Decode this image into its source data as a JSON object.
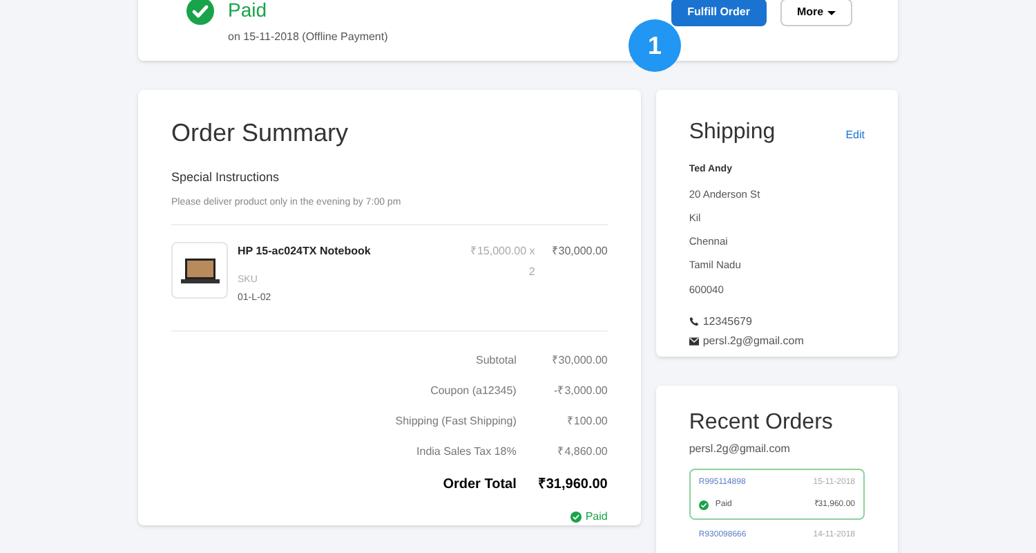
{
  "payment": {
    "status": "Paid",
    "detail": "on 15-11-2018 (Offline Payment)",
    "actions": [
      {
        "label": "Fulfill Order",
        "kind": "primary"
      },
      {
        "label": "More",
        "kind": "dropdown"
      }
    ]
  },
  "step_badge": "1",
  "order_summary": {
    "title": "Order Summary",
    "instructions_label": "Special Instructions",
    "instructions": "Please deliver product only in the evening by 7:00 pm",
    "items": [
      {
        "name": "HP 15-ac024TX Notebook",
        "sku_label": "SKU",
        "sku": "01-L-02",
        "unit_price": "₹15,000.00 x",
        "quantity": "2",
        "total": "₹30,000.00"
      }
    ],
    "totals": [
      {
        "label": "Subtotal",
        "value": "₹30,000.00",
        "kind": "line"
      },
      {
        "label": "Coupon (a12345)",
        "value": "-₹3,000.00",
        "kind": "line"
      },
      {
        "label": "Shipping (Fast Shipping)",
        "value": "₹100.00",
        "kind": "line"
      },
      {
        "label": "India Sales Tax 18%",
        "value": "₹4,860.00",
        "kind": "line"
      },
      {
        "label": "Order Total",
        "value": "₹31,960.00",
        "kind": "total"
      }
    ],
    "payment_status": "Paid"
  },
  "shipping": {
    "title": "Shipping",
    "edit": "Edit",
    "name": "Ted Andy",
    "address": [
      "20 Anderson St",
      "Kil",
      "Chennai",
      "Tamil Nadu",
      "600040"
    ],
    "phone": "12345679",
    "email": "persl.2g@gmail.com"
  },
  "recent_orders": {
    "title": "Recent Orders",
    "email": "persl.2g@gmail.com",
    "orders": [
      {
        "number": "R995114898",
        "date": "15-11-2018",
        "status": "Paid",
        "total": "₹31,960.00",
        "selected": true
      },
      {
        "number": "R930098666",
        "date": "14-11-2018",
        "selected": false
      }
    ]
  }
}
